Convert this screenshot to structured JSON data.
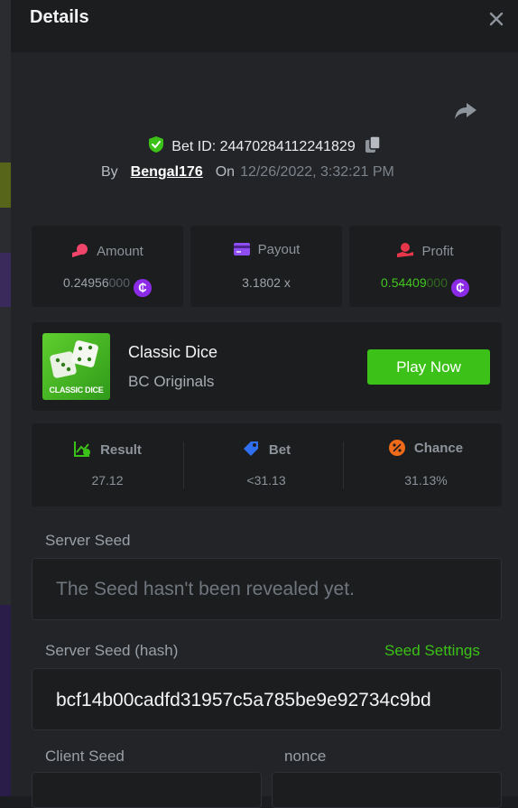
{
  "dialog": {
    "title": "Details"
  },
  "bet": {
    "id_text": "Bet ID: 24470284112241829",
    "by_label": "By",
    "user": "Bengal176",
    "on_label": "On",
    "date": "12/26/2022, 3:32:21 PM"
  },
  "stats": {
    "amount": {
      "label": "Amount",
      "value_main": "0.24956",
      "value_dim": "000"
    },
    "payout": {
      "label": "Payout",
      "value": "3.1802 x"
    },
    "profit": {
      "label": "Profit",
      "value_main": "0.54409",
      "value_dim": "000"
    },
    "coin_symbol": "₵"
  },
  "game": {
    "thumb_label": "CLASSIC DICE",
    "name": "Classic Dice",
    "provider": "BC Originals",
    "play_label": "Play Now"
  },
  "result": {
    "result_label": "Result",
    "result_value": "27.12",
    "bet_label": "Bet",
    "bet_value": "<31.13",
    "chance_label": "Chance",
    "chance_value": "31.13%"
  },
  "seeds": {
    "server_seed_label": "Server Seed",
    "server_seed_value": "The Seed hasn't been revealed yet.",
    "server_hash_label": "Server Seed (hash)",
    "seed_settings_label": "Seed Settings",
    "server_hash_value": "bcf14b00cadfd31957c5a785be9e92734c9bd",
    "client_seed_label": "Client Seed",
    "nonce_label": "nonce"
  },
  "colors": {
    "accent_green": "#3bc117",
    "coin_purple": "#8b2be8",
    "profit_green": "#43c71f"
  },
  "icons": [
    "close-icon",
    "share-icon",
    "shield-check-icon",
    "copy-icon",
    "amount-icon",
    "payout-icon",
    "profit-icon",
    "coin-icon",
    "result-icon",
    "bet-tag-icon",
    "chance-icon"
  ]
}
